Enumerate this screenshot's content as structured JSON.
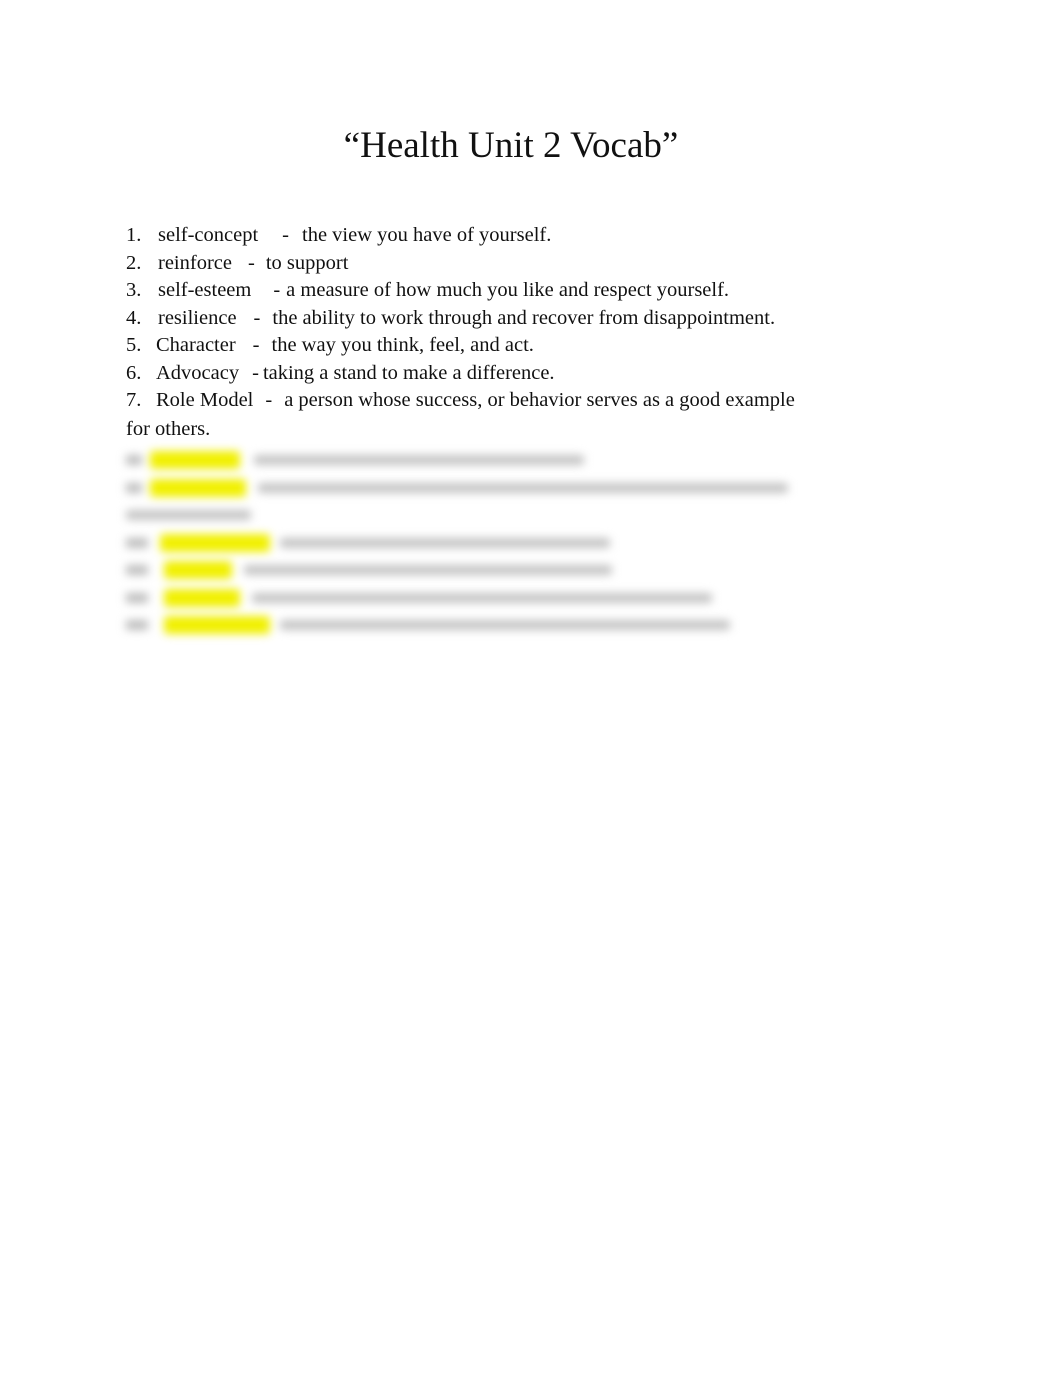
{
  "document": {
    "title": "“Health Unit 2 Vocab”",
    "highlight_color": "#f6f536",
    "items": [
      {
        "number": "1.",
        "term": "self-concept",
        "separator": "-",
        "definition": "the view you have of yourself."
      },
      {
        "number": "2.",
        "term": "reinforce",
        "separator": "-",
        "definition": "to support"
      },
      {
        "number": "3.",
        "term": "self-esteem",
        "separator": "-",
        "definition": "a measure of how much you like and respect yourself."
      },
      {
        "number": "4.",
        "term": "resilience",
        "separator": "-",
        "definition": "the ability to work through and recover from disappointment."
      },
      {
        "number": "5.",
        "term": "Character",
        "separator": "-",
        "definition": "the way you think, feel, and act."
      },
      {
        "number": "6.",
        "term": "Advocacy",
        "separator": "-",
        "definition": "taking a stand to make a difference."
      },
      {
        "number": "7.",
        "term": "Role Model",
        "separator": "-",
        "definition": "a person whose success, or behavior serves as a good example",
        "continuation": "for others."
      }
    ],
    "blurred_items_note": "Items 8–13 are blurred/obscured and unreadable"
  }
}
